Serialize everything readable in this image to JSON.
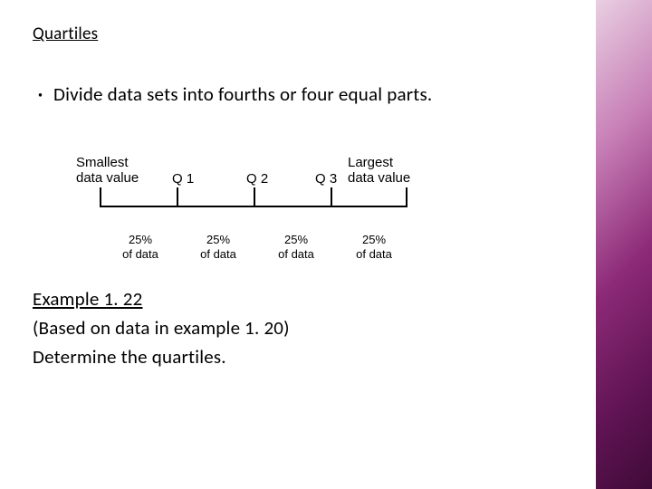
{
  "title": "Quartiles",
  "bullet": "Divide data sets into fourths or four equal parts.",
  "diagram": {
    "leftLabel": "Smallest\ndata value",
    "q1": "Q 1",
    "q2": "Q 2",
    "q3": "Q 3",
    "rightLabel": "Largest\ndata value",
    "seg1a": "25%",
    "seg1b": "of data",
    "seg2a": "25%",
    "seg2b": "of data",
    "seg3a": "25%",
    "seg3b": "of data",
    "seg4a": "25%",
    "seg4b": "of data"
  },
  "example": {
    "heading": "Example 1. 22",
    "line1": "(Based on data in example 1. 20)",
    "line2": "Determine the quartiles."
  }
}
